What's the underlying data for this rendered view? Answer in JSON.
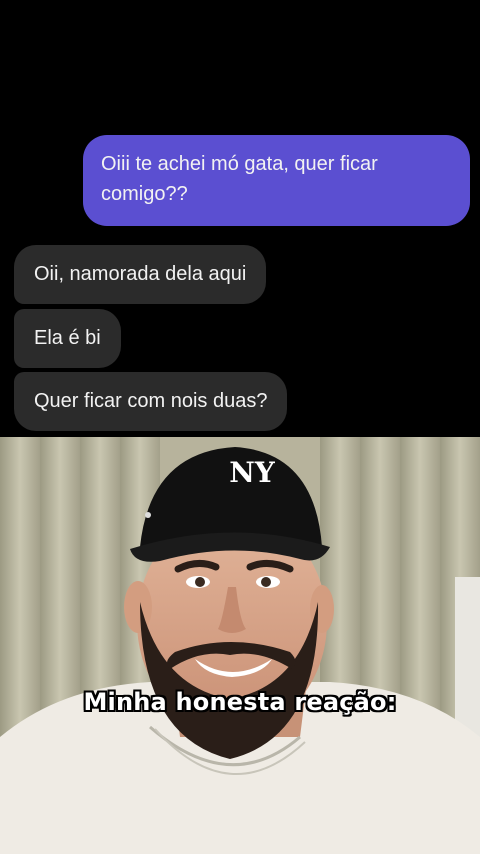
{
  "chat": {
    "sent_message": "Oiii te achei mó gata, quer ficar comigo??",
    "received_messages": [
      "Oii, namorada dela aqui",
      "Ela é bi",
      "Quer ficar com nois duas?"
    ]
  },
  "meme": {
    "caption": "Minha honesta reação:",
    "cap_logo_text": "NY"
  },
  "colors": {
    "sent_bubble": "#5b4fd1",
    "received_bubble": "#2b2b2b",
    "background": "#000000"
  }
}
